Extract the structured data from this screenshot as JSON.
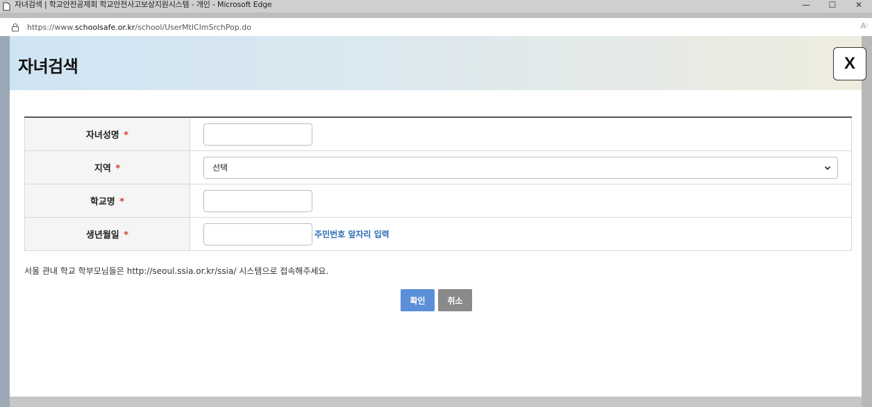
{
  "browser": {
    "window_title": "자녀검색 | 학교안전공제회 학교안전사고보상지원시스템 - 개인 - Microsoft Edge",
    "url_prefix": "https://www.",
    "url_domain": "schoolsafe.or.kr",
    "url_path": "/school/UserMtlClmSrchPop.do",
    "controls": {
      "minimize": "—",
      "maximize": "☐",
      "close": "✕"
    },
    "read_aloud": "A⁾"
  },
  "popup": {
    "title": "자녀검색",
    "close_label": "X"
  },
  "form": {
    "fields": [
      {
        "label": "자녀성명",
        "required": "*",
        "type": "text",
        "value": ""
      },
      {
        "label": "지역",
        "required": "*",
        "type": "select",
        "selected": "선택"
      },
      {
        "label": "학교명",
        "required": "*",
        "type": "text",
        "value": ""
      },
      {
        "label": "생년월일",
        "required": "*",
        "type": "text",
        "value": "",
        "hint": "주민번호 앞자리 입력"
      }
    ]
  },
  "notice": "서울 관내 학교 학부모님들은 http://seoul.ssia.or.kr/ssia/ 시스템으로 접속해주세요.",
  "buttons": {
    "confirm": "확인",
    "cancel": "취소"
  },
  "colors": {
    "confirm_bg": "#5b8fd8",
    "cancel_bg": "#8a8a8a",
    "required": "#d9382f",
    "hint": "#2a6bb5"
  },
  "icons": {
    "page": "page-icon",
    "lock": "lock-icon",
    "chevron": "chevron-down-icon"
  }
}
